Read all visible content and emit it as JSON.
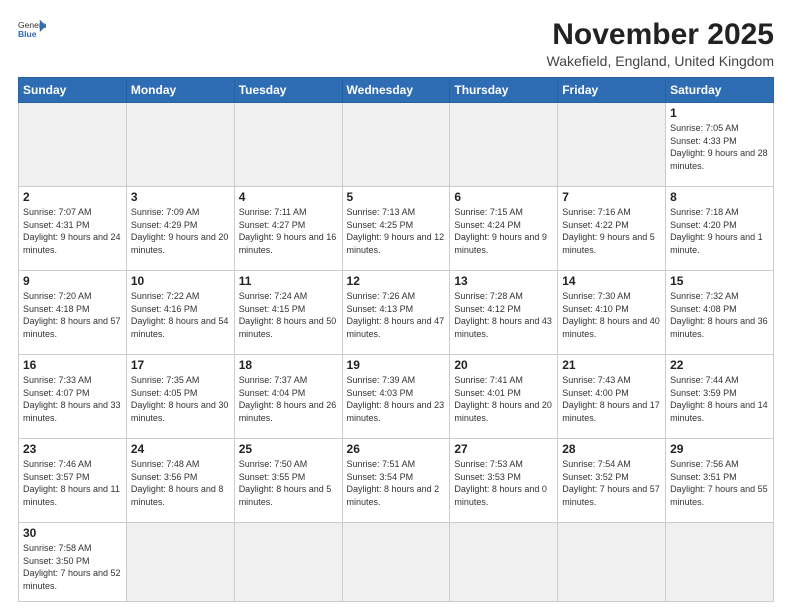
{
  "header": {
    "logo_general": "General",
    "logo_blue": "Blue",
    "month_title": "November 2025",
    "location": "Wakefield, England, United Kingdom"
  },
  "weekdays": [
    "Sunday",
    "Monday",
    "Tuesday",
    "Wednesday",
    "Thursday",
    "Friday",
    "Saturday"
  ],
  "weeks": [
    [
      {
        "day": "",
        "info": ""
      },
      {
        "day": "",
        "info": ""
      },
      {
        "day": "",
        "info": ""
      },
      {
        "day": "",
        "info": ""
      },
      {
        "day": "",
        "info": ""
      },
      {
        "day": "",
        "info": ""
      },
      {
        "day": "1",
        "info": "Sunrise: 7:05 AM\nSunset: 4:33 PM\nDaylight: 9 hours\nand 28 minutes."
      }
    ],
    [
      {
        "day": "2",
        "info": "Sunrise: 7:07 AM\nSunset: 4:31 PM\nDaylight: 9 hours\nand 24 minutes."
      },
      {
        "day": "3",
        "info": "Sunrise: 7:09 AM\nSunset: 4:29 PM\nDaylight: 9 hours\nand 20 minutes."
      },
      {
        "day": "4",
        "info": "Sunrise: 7:11 AM\nSunset: 4:27 PM\nDaylight: 9 hours\nand 16 minutes."
      },
      {
        "day": "5",
        "info": "Sunrise: 7:13 AM\nSunset: 4:25 PM\nDaylight: 9 hours\nand 12 minutes."
      },
      {
        "day": "6",
        "info": "Sunrise: 7:15 AM\nSunset: 4:24 PM\nDaylight: 9 hours\nand 9 minutes."
      },
      {
        "day": "7",
        "info": "Sunrise: 7:16 AM\nSunset: 4:22 PM\nDaylight: 9 hours\nand 5 minutes."
      },
      {
        "day": "8",
        "info": "Sunrise: 7:18 AM\nSunset: 4:20 PM\nDaylight: 9 hours\nand 1 minute."
      }
    ],
    [
      {
        "day": "9",
        "info": "Sunrise: 7:20 AM\nSunset: 4:18 PM\nDaylight: 8 hours\nand 57 minutes."
      },
      {
        "day": "10",
        "info": "Sunrise: 7:22 AM\nSunset: 4:16 PM\nDaylight: 8 hours\nand 54 minutes."
      },
      {
        "day": "11",
        "info": "Sunrise: 7:24 AM\nSunset: 4:15 PM\nDaylight: 8 hours\nand 50 minutes."
      },
      {
        "day": "12",
        "info": "Sunrise: 7:26 AM\nSunset: 4:13 PM\nDaylight: 8 hours\nand 47 minutes."
      },
      {
        "day": "13",
        "info": "Sunrise: 7:28 AM\nSunset: 4:12 PM\nDaylight: 8 hours\nand 43 minutes."
      },
      {
        "day": "14",
        "info": "Sunrise: 7:30 AM\nSunset: 4:10 PM\nDaylight: 8 hours\nand 40 minutes."
      },
      {
        "day": "15",
        "info": "Sunrise: 7:32 AM\nSunset: 4:08 PM\nDaylight: 8 hours\nand 36 minutes."
      }
    ],
    [
      {
        "day": "16",
        "info": "Sunrise: 7:33 AM\nSunset: 4:07 PM\nDaylight: 8 hours\nand 33 minutes."
      },
      {
        "day": "17",
        "info": "Sunrise: 7:35 AM\nSunset: 4:05 PM\nDaylight: 8 hours\nand 30 minutes."
      },
      {
        "day": "18",
        "info": "Sunrise: 7:37 AM\nSunset: 4:04 PM\nDaylight: 8 hours\nand 26 minutes."
      },
      {
        "day": "19",
        "info": "Sunrise: 7:39 AM\nSunset: 4:03 PM\nDaylight: 8 hours\nand 23 minutes."
      },
      {
        "day": "20",
        "info": "Sunrise: 7:41 AM\nSunset: 4:01 PM\nDaylight: 8 hours\nand 20 minutes."
      },
      {
        "day": "21",
        "info": "Sunrise: 7:43 AM\nSunset: 4:00 PM\nDaylight: 8 hours\nand 17 minutes."
      },
      {
        "day": "22",
        "info": "Sunrise: 7:44 AM\nSunset: 3:59 PM\nDaylight: 8 hours\nand 14 minutes."
      }
    ],
    [
      {
        "day": "23",
        "info": "Sunrise: 7:46 AM\nSunset: 3:57 PM\nDaylight: 8 hours\nand 11 minutes."
      },
      {
        "day": "24",
        "info": "Sunrise: 7:48 AM\nSunset: 3:56 PM\nDaylight: 8 hours\nand 8 minutes."
      },
      {
        "day": "25",
        "info": "Sunrise: 7:50 AM\nSunset: 3:55 PM\nDaylight: 8 hours\nand 5 minutes."
      },
      {
        "day": "26",
        "info": "Sunrise: 7:51 AM\nSunset: 3:54 PM\nDaylight: 8 hours\nand 2 minutes."
      },
      {
        "day": "27",
        "info": "Sunrise: 7:53 AM\nSunset: 3:53 PM\nDaylight: 8 hours\nand 0 minutes."
      },
      {
        "day": "28",
        "info": "Sunrise: 7:54 AM\nSunset: 3:52 PM\nDaylight: 7 hours\nand 57 minutes."
      },
      {
        "day": "29",
        "info": "Sunrise: 7:56 AM\nSunset: 3:51 PM\nDaylight: 7 hours\nand 55 minutes."
      }
    ],
    [
      {
        "day": "30",
        "info": "Sunrise: 7:58 AM\nSunset: 3:50 PM\nDaylight: 7 hours\nand 52 minutes."
      },
      {
        "day": "",
        "info": ""
      },
      {
        "day": "",
        "info": ""
      },
      {
        "day": "",
        "info": ""
      },
      {
        "day": "",
        "info": ""
      },
      {
        "day": "",
        "info": ""
      },
      {
        "day": "",
        "info": ""
      }
    ]
  ]
}
